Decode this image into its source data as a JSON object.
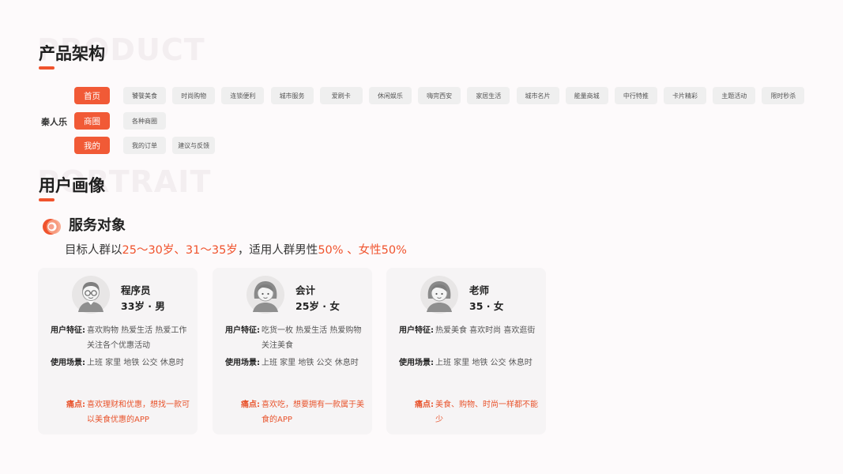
{
  "product": {
    "bg_word": "PRODUCT",
    "title": "产品架构",
    "root": "秦人乐",
    "rows": [
      {
        "tab": "首页",
        "items": [
          "饕餮美食",
          "时尚购物",
          "连锁便利",
          "城市服务",
          "爱刷卡",
          "休闲娱乐",
          "嗨完西安",
          "家居生活",
          "城市名片",
          "能量商城",
          "中行特推",
          "卡片精彩",
          "主题活动",
          "限时秒杀"
        ]
      },
      {
        "tab": "商圈",
        "items": [
          "各种商圈"
        ]
      },
      {
        "tab": "我的",
        "items": [
          "我的订单",
          "建议与反馈"
        ]
      }
    ]
  },
  "portrait": {
    "bg_word": "PORTRAIT",
    "title": "用户画像"
  },
  "service": {
    "title": "服务对象",
    "desc_prefix": "目标人群以",
    "desc_age": "25～30岁、31～35岁",
    "desc_mid": "，适用人群男性",
    "desc_male": "50%",
    "desc_sep": " 、",
    "desc_female": "女性50%"
  },
  "personas": [
    {
      "avatar_icon": "male-glasses-avatar-icon",
      "name": "程序员",
      "age": "33岁 · 男",
      "feature_label": "用户特征:",
      "feature": "喜欢购物 热爱生活 热爱工作关注各个优惠活动",
      "scene_label": "使用场景:",
      "scene": "上班 家里 地铁 公交 休息时",
      "pain_label": "痛点:",
      "pain": "喜欢理财和优惠，想找一款可以美食优惠的APP"
    },
    {
      "avatar_icon": "female-avatar-icon",
      "name": "会计",
      "age": "25岁 · 女",
      "feature_label": "用户特征:",
      "feature": "吃货一枚 热爱生活 热爱购物 关注美食",
      "scene_label": "使用场景:",
      "scene": "上班 家里 地铁 公交 休息时",
      "pain_label": "痛点:",
      "pain": "喜欢吃，想要拥有一款属于美食的APP"
    },
    {
      "avatar_icon": "female-avatar-icon",
      "name": "老师",
      "age": "35 · 女",
      "feature_label": "用户特征:",
      "feature": "热爱美食 喜欢时尚 喜欢逛街",
      "scene_label": "使用场景:",
      "scene": "上班 家里 地铁 公交 休息时",
      "pain_label": "痛点:",
      "pain": "美食、购物、时尚一样都不能少"
    }
  ],
  "colors": {
    "accent": "#f0532d",
    "chip_bg": "#efefef",
    "card_bg": "#f6f4f5"
  }
}
